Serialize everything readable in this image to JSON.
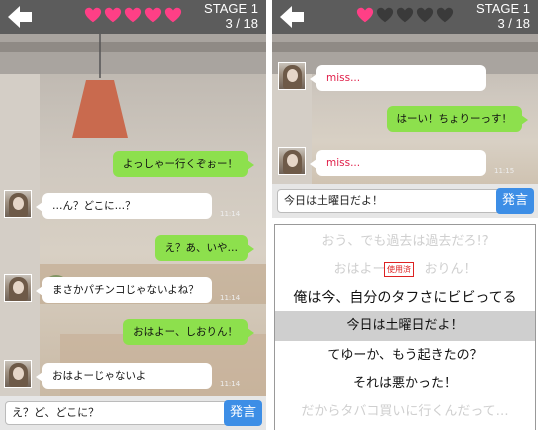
{
  "left": {
    "stage_label": "STAGE 1",
    "progress_text": "3 / 18",
    "hearts": [
      true,
      true,
      true,
      true,
      true
    ],
    "messages": [
      {
        "side": "out",
        "text": "よっしゃー行くぞぉー！",
        "time": ""
      },
      {
        "side": "in",
        "text": "…ん？どこに…？",
        "time": "11:14"
      },
      {
        "side": "out",
        "text": "え？あ、いや…",
        "time": ""
      },
      {
        "side": "in",
        "text": "まさかパチンコじゃないよね？",
        "time": "11:14"
      },
      {
        "side": "out",
        "text": "おはよー、しおりん！",
        "time": ""
      },
      {
        "side": "in",
        "text": "おはよーじゃないよ",
        "time": "11:14"
      }
    ],
    "input_value": "え？ど、どこに？",
    "send_label": "発言"
  },
  "right": {
    "stage_label": "STAGE 1",
    "progress_text": "3 / 18",
    "hearts": [
      true,
      false,
      false,
      false,
      false
    ],
    "messages": [
      {
        "side": "in",
        "text": "miss...",
        "time": ""
      },
      {
        "side": "out",
        "text": "はーい！ちょりーっす！",
        "time": ""
      },
      {
        "side": "in",
        "text": "miss...",
        "time": "11:15"
      }
    ],
    "input_value": "今日は土曜日だよ！",
    "send_label": "発言",
    "choices": [
      {
        "text": "おう、でも過去は過去だろ!?",
        "state": "faded"
      },
      {
        "text": "おはよー　　　おりん！",
        "state": "faded"
      },
      {
        "text": "俺は今、自分のタフさにビビってる",
        "state": "normal"
      },
      {
        "text": "今日は土曜日だよ！",
        "state": "selected"
      },
      {
        "text": "てゆーか、もう起きたの？",
        "state": "normal"
      },
      {
        "text": "それは悪かった！",
        "state": "normal"
      },
      {
        "text": "だからタバコ買いに行くんだって…",
        "state": "faded"
      }
    ],
    "used_stamp": "使用済"
  },
  "colors": {
    "topbar": "#5c5c5c",
    "heart_full": "#ff3f86",
    "heart_empty": "#3a3a3a",
    "bubble_out": "#8de04d",
    "send_button": "#3d8ee6",
    "miss_text": "#e0204a"
  },
  "icons": {
    "back": "back-arrow-icon",
    "heart": "heart-icon"
  }
}
